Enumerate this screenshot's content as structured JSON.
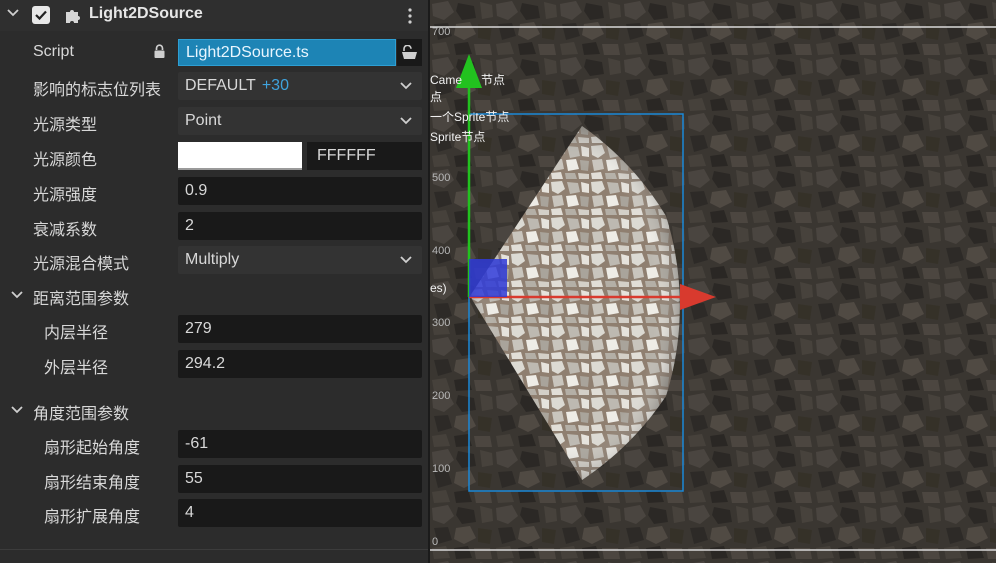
{
  "component": {
    "title": "Light2DSource",
    "enabled": true
  },
  "properties": {
    "script": {
      "label": "Script",
      "value": "Light2DSource.ts"
    },
    "flags": {
      "label": "影响的标志位列表",
      "value": "DEFAULT",
      "extra": "+30"
    },
    "light_type": {
      "label": "光源类型",
      "value": "Point"
    },
    "light_color": {
      "label": "光源颜色",
      "swatch": "#FFFFFF",
      "hex": "FFFFFF"
    },
    "intensity": {
      "label": "光源强度",
      "value": "0.9"
    },
    "falloff": {
      "label": "衰减系数",
      "value": "2"
    },
    "blend_mode": {
      "label": "光源混合模式",
      "value": "Multiply"
    }
  },
  "distance_section": {
    "label": "距离范围参数",
    "inner_radius": {
      "label": "内层半径",
      "value": "279"
    },
    "outer_radius": {
      "label": "外层半径",
      "value": "294.2"
    }
  },
  "angle_section": {
    "label": "角度范围参数",
    "start_angle": {
      "label": "扇形起始角度",
      "value": "-61"
    },
    "end_angle": {
      "label": "扇形结束角度",
      "value": "55"
    },
    "spread_angle": {
      "label": "扇形扩展角度",
      "value": "4"
    }
  },
  "scene": {
    "ruler_ticks": [
      "700",
      "500",
      "400",
      "300",
      "200",
      "100",
      "0"
    ],
    "hierarchy_fragments": [
      "Came",
      "节点",
      "点",
      "一个Sprite节点",
      "Sprite节点",
      "es)"
    ],
    "colors": {
      "x_axis": "#d83a2e",
      "y_axis": "#22c21f",
      "selection": "#1b88d8",
      "ground": "#3a3631"
    }
  }
}
